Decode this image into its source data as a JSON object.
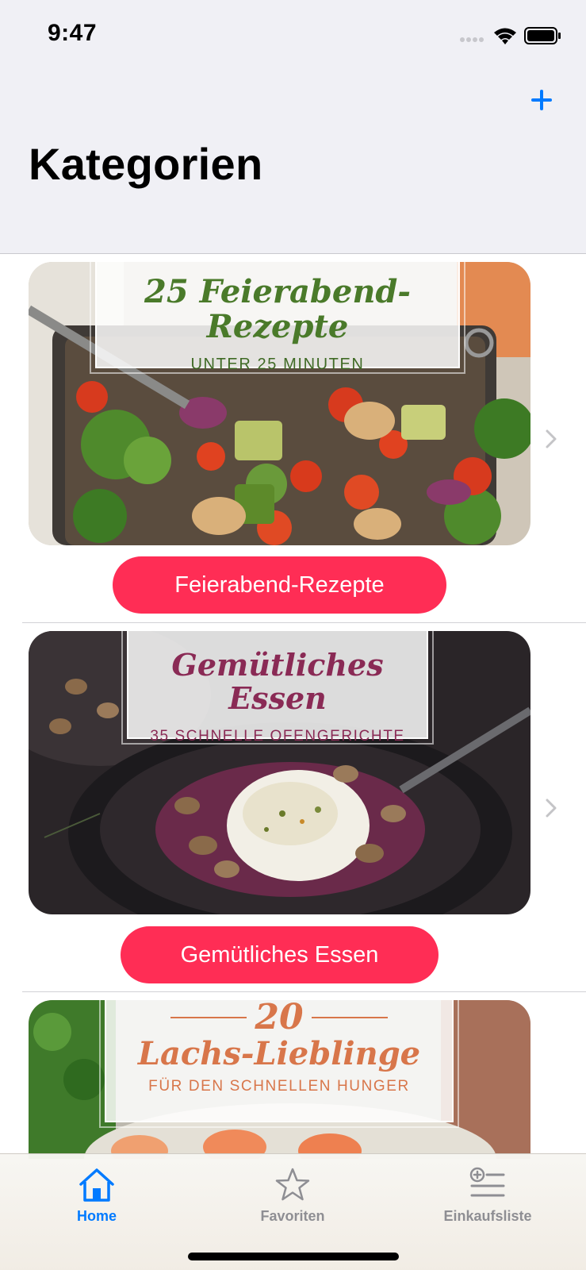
{
  "status_bar": {
    "time": "9:47"
  },
  "nav": {
    "title": "Kategorien",
    "add_icon": "plus-icon"
  },
  "categories": [
    {
      "overlay_title": "25 Feierabend-Rezepte",
      "overlay_subtitle": "UNTER 25 MINUTEN",
      "button_label": "Feierabend-Rezepte",
      "title_color": "#4a7a2a",
      "subtitle_color": "#3f6a25"
    },
    {
      "overlay_title": "Gemütliches Essen",
      "overlay_subtitle": "35 SCHNELLE OFENGERICHTE",
      "button_label": "Gemütliches Essen",
      "title_color": "#8a2a55",
      "subtitle_color": "#8a2a55"
    },
    {
      "overlay_number": "20",
      "overlay_title": "Lachs-Lieblinge",
      "overlay_subtitle": "FÜR DEN SCHNELLEN HUNGER",
      "title_color": "#d8764a",
      "subtitle_color": "#d8764a"
    }
  ],
  "tabbar": {
    "items": [
      {
        "label": "Home",
        "icon": "house-icon",
        "active": true
      },
      {
        "label": "Favoriten",
        "icon": "star-icon",
        "active": false
      },
      {
        "label": "Einkaufsliste",
        "icon": "shopping-list-icon",
        "active": false
      }
    ]
  },
  "colors": {
    "accent": "#007aff",
    "pill": "#ff2d55",
    "inactive": "#8e8e93",
    "header_bg": "#f0f0f5"
  }
}
